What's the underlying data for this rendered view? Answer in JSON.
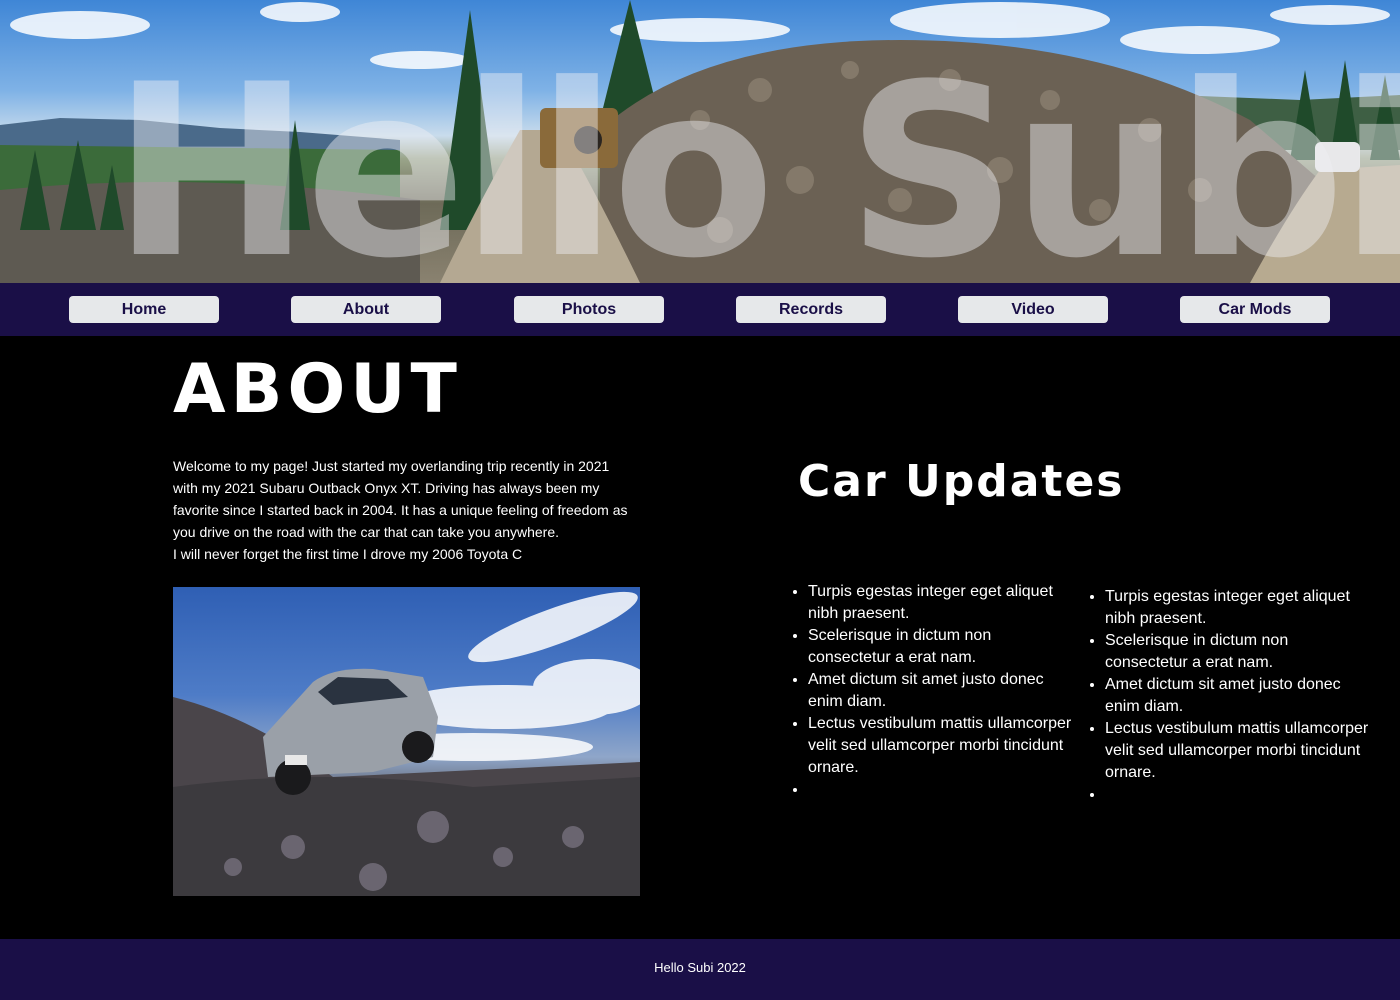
{
  "hero": {
    "title": "Hello Subi"
  },
  "nav": {
    "items": [
      {
        "label": "Home"
      },
      {
        "label": "About"
      },
      {
        "label": "Photos"
      },
      {
        "label": "Records"
      },
      {
        "label": "Video"
      },
      {
        "label": "Car Mods"
      }
    ]
  },
  "about": {
    "heading": "ABOUT",
    "paragraphs": [
      "Welcome to my page! Just started my overlanding trip recently in 2021 with my 2021 Subaru Outback Onyx XT. Driving has always been my favorite since I started back in 2004. It has a unique feeling of freedom as you drive on the road with the car that can take you anywhere.",
      "I will never forget the first time I drove my 2006 Toyota C"
    ]
  },
  "updates": {
    "heading": "Car Updates",
    "columns": [
      {
        "items": [
          "Turpis egestas integer eget aliquet nibh praesent.",
          "Scelerisque in dictum non consectetur a erat nam.",
          "Amet dictum sit amet justo donec enim diam.",
          "Lectus vestibulum mattis ullamcorper velit sed ullamcorper morbi tincidunt ornare.",
          ""
        ]
      },
      {
        "items": [
          "Turpis egestas integer eget aliquet nibh praesent.",
          "Scelerisque in dictum non consectetur a erat nam.",
          "Amet dictum sit amet justo donec enim diam.",
          "Lectus vestibulum mattis ullamcorper velit sed ullamcorper morbi tincidunt ornare.",
          ""
        ]
      }
    ]
  },
  "footer": {
    "text": "Hello Subi 2022"
  },
  "colors": {
    "nav_background": "#1a0f47",
    "nav_button": "#e6e8ea",
    "nav_button_text": "#1a0f47",
    "page_background": "#000000",
    "text": "#ffffff"
  },
  "icons": {
    "hero_image": "panorama-offroad-photo",
    "about_image": "subaru-on-rocky-hill-photo"
  }
}
